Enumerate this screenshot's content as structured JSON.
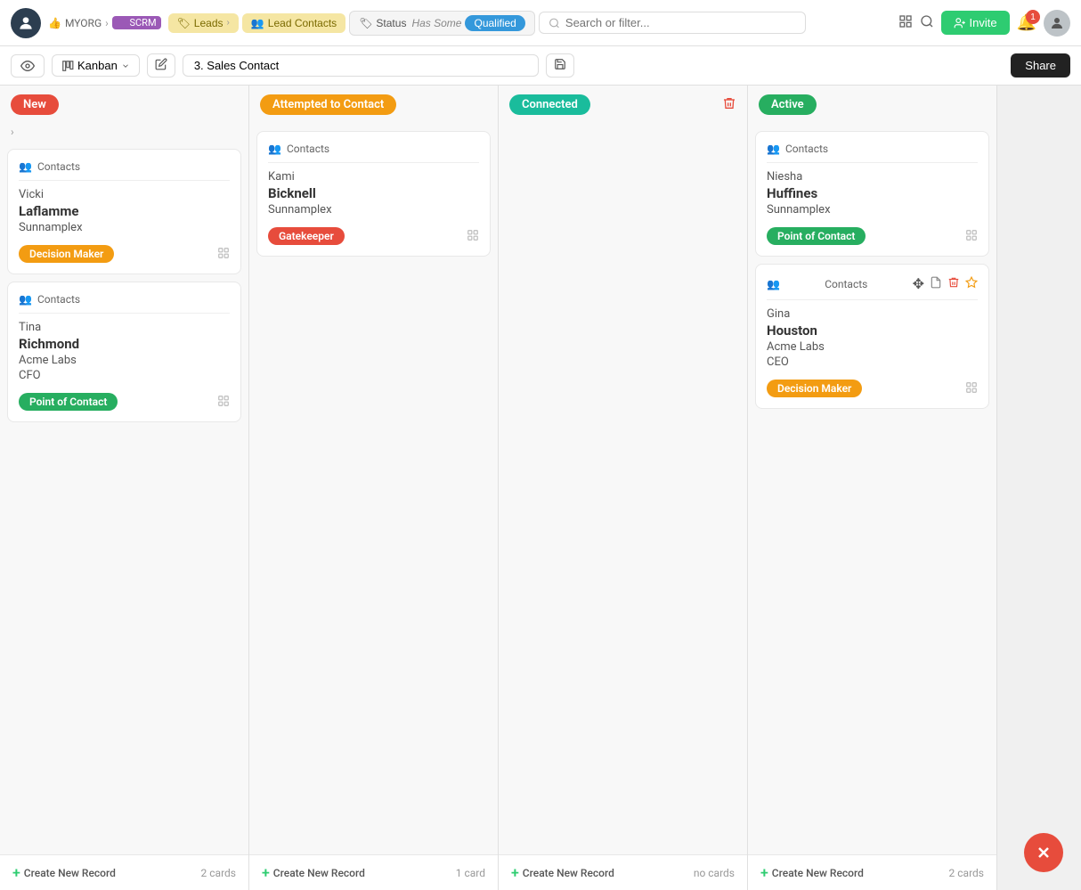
{
  "app": {
    "org": "MYORG",
    "module": "SCRM"
  },
  "nav": {
    "avatar_initials": "👤",
    "breadcrumb_arrow": "›",
    "invite_label": "Invite",
    "notification_count": "1"
  },
  "filter_bar": {
    "leads_label": "Leads",
    "lead_contacts_label": "Lead Contacts",
    "status_label": "Status",
    "has_some_label": "Has Some",
    "qualified_label": "Qualified",
    "search_placeholder": "Search or filter..."
  },
  "second_toolbar": {
    "view_icon": "👁",
    "kanban_label": "Kanban",
    "view_name": "3. Sales Contact",
    "share_label": "Share"
  },
  "columns": [
    {
      "id": "new",
      "badge_label": "New",
      "badge_class": "badge-new",
      "cards": [
        {
          "id": "card1",
          "section_label": "Contacts",
          "first_name": "Vicki",
          "last_name": "Laflamme",
          "company": "Sunnamplex",
          "role": "",
          "role_badge": "Decision Maker",
          "role_badge_class": "badge-decision",
          "has_actions": false
        },
        {
          "id": "card2",
          "section_label": "Contacts",
          "first_name": "Tina",
          "last_name": "Richmond",
          "company": "Acme Labs",
          "role": "CFO",
          "role_badge": "Point of Contact",
          "role_badge_class": "badge-poc",
          "has_actions": false
        }
      ],
      "footer_label": "Create New Record",
      "card_count": "2 cards"
    },
    {
      "id": "attempted",
      "badge_label": "Attempted to Contact",
      "badge_class": "badge-attempted",
      "cards": [
        {
          "id": "card3",
          "section_label": "Contacts",
          "first_name": "Kami",
          "last_name": "Bicknell",
          "company": "Sunnamplex",
          "role": "",
          "role_badge": "Gatekeeper",
          "role_badge_class": "badge-gatekeeper",
          "has_actions": false
        }
      ],
      "footer_label": "Create New Record",
      "card_count": "1 card"
    },
    {
      "id": "connected",
      "badge_label": "Connected",
      "badge_class": "badge-connected",
      "cards": [],
      "footer_label": "Create New Record",
      "card_count": "no cards"
    },
    {
      "id": "active",
      "badge_label": "Active",
      "badge_class": "badge-active",
      "cards": [
        {
          "id": "card4",
          "section_label": "Contacts",
          "first_name": "Niesha",
          "last_name": "Huffines",
          "company": "Sunnamplex",
          "role": "",
          "role_badge": "Point of Contact",
          "role_badge_class": "badge-poc",
          "has_actions": false
        },
        {
          "id": "card5",
          "section_label": "Contacts",
          "first_name": "Gina",
          "last_name": "Houston",
          "company": "Acme Labs",
          "role": "CEO",
          "role_badge": "Decision Maker",
          "role_badge_class": "badge-decision",
          "has_actions": true
        }
      ],
      "footer_label": "Create New Record",
      "card_count": "2 cards"
    }
  ]
}
